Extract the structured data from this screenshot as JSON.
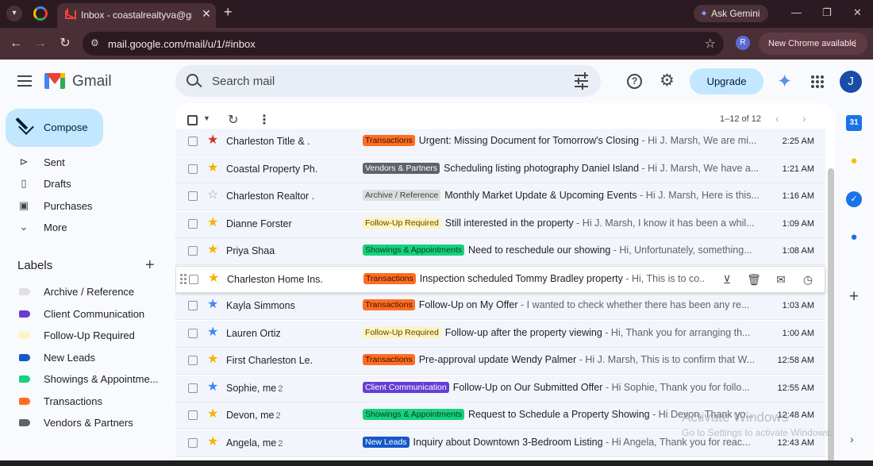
{
  "browser": {
    "tab_title": "Inbox - coastalrealtyva@gmail.",
    "tab_close": "✕",
    "new_tab": "+",
    "ask_gemini": "Ask Gemini",
    "url": "mail.google.com/mail/u/1/#inbox",
    "profile_initial": "R",
    "update_text": "New Chrome available",
    "window_controls": [
      "—",
      "❐",
      "✕"
    ]
  },
  "gmail": {
    "brand": "Gmail",
    "search_placeholder": "Search mail",
    "upgrade": "Upgrade",
    "account_initial": "J"
  },
  "sidebar": {
    "compose": "Compose",
    "nav": [
      {
        "label": "Sent",
        "icon": "send-icon",
        "glyph": "⊳"
      },
      {
        "label": "Drafts",
        "icon": "draft-icon",
        "glyph": "▯"
      },
      {
        "label": "Purchases",
        "icon": "purchases-icon",
        "glyph": "▣"
      },
      {
        "label": "More",
        "icon": "chevron-down-icon",
        "glyph": "⌄"
      }
    ],
    "labels_heading": "Labels",
    "add_label": "+",
    "labels": [
      {
        "name": "Archive / Reference",
        "color": "#e0e0e0"
      },
      {
        "name": "Client Communication",
        "color": "#653ed4"
      },
      {
        "name": "Follow-Up Required",
        "color": "#fff4bd"
      },
      {
        "name": "New Leads",
        "color": "#1457c8"
      },
      {
        "name": "Showings & Appointme...",
        "color": "#16d17d"
      },
      {
        "name": "Transactions",
        "color": "#ff6d23"
      },
      {
        "name": "Vendors & Partners",
        "color": "#5f6368"
      }
    ]
  },
  "toolbar": {
    "page_count": "1–12 of 12"
  },
  "label_styles": {
    "Transactions": {
      "bg": "#ff6d23",
      "fg": "#3b1100"
    },
    "Vendors & Partners": {
      "bg": "#5f6368",
      "fg": "#ffffff"
    },
    "Archive / Reference": {
      "bg": "#dddddd",
      "fg": "#3c4043"
    },
    "Follow-Up Required": {
      "bg": "#fff4bd",
      "fg": "#5f4700"
    },
    "Showings & Appointments": {
      "bg": "#16d17d",
      "fg": "#0b3b23"
    },
    "Client Communication": {
      "bg": "#653ed4",
      "fg": "#ffffff"
    },
    "New Leads": {
      "bg": "#1457c8",
      "fg": "#ffffff"
    }
  },
  "emails": [
    {
      "sender": "Charleston Title & .",
      "count": "",
      "star": "red",
      "label": "Transactions",
      "subject": "Urgent: Missing Document for Tomorrow's Closing",
      "snippet": "Hi J. Marsh, We are mi...",
      "time": "2:25 AM"
    },
    {
      "sender": "Coastal Property Ph.",
      "count": "",
      "star": "yellow",
      "label": "Vendors & Partners",
      "subject": "Scheduling listing photography Daniel Island",
      "snippet": "Hi J. Marsh, We have a...",
      "time": "1:21 AM"
    },
    {
      "sender": "Charleston Realtor .",
      "count": "",
      "star": "empty",
      "label": "Archive / Reference",
      "subject": "Monthly Market Update & Upcoming Events",
      "snippet": "Hi J. Marsh, Here is this...",
      "time": "1:16 AM"
    },
    {
      "sender": "Dianne Forster",
      "count": "",
      "star": "yellow",
      "label": "Follow-Up Required",
      "subject": "Still interested in the property",
      "snippet": "Hi J. Marsh, I know it has been a whil...",
      "time": "1:09 AM"
    },
    {
      "sender": "Priya Shaa",
      "count": "",
      "star": "yellow",
      "label": "Showings & Appointments",
      "subject": "Need to reschedule our showing",
      "snippet": "Hi, Unfortunately, something...",
      "time": "1:08 AM"
    },
    {
      "sender": "Charleston Home Ins.",
      "count": "",
      "star": "yellow",
      "label": "Transactions",
      "subject": "Inspection scheduled Tommy Bradley property",
      "snippet": "Hi, This is to co...",
      "time": "",
      "hovered": true
    },
    {
      "sender": "Kayla Simmons",
      "count": "",
      "star": "blue",
      "label": "Transactions",
      "subject": "Follow-Up on My Offer",
      "snippet": "I wanted to check whether there has been any re...",
      "time": "1:03 AM"
    },
    {
      "sender": "Lauren Ortiz",
      "count": "",
      "star": "blue",
      "label": "Follow-Up Required",
      "subject": "Follow-up after the property viewing",
      "snippet": "Hi, Thank you for arranging th...",
      "time": "1:00 AM"
    },
    {
      "sender": "First Charleston Le.",
      "count": "",
      "star": "yellow",
      "label": "Transactions",
      "subject": "Pre-approval update Wendy Palmer",
      "snippet": "Hi J. Marsh, This is to confirm that W...",
      "time": "12:58 AM"
    },
    {
      "sender": "Sophie, me",
      "count": "2",
      "star": "blue",
      "label": "Client Communication",
      "subject": "Follow-Up on Our Submitted Offer",
      "snippet": "Hi Sophie, Thank you for follo...",
      "time": "12:55 AM"
    },
    {
      "sender": "Devon, me",
      "count": "2",
      "star": "yellow",
      "label": "Showings & Appointments",
      "subject": "Request to Schedule a Property Showing",
      "snippet": "Hi Devon, Thank yo...",
      "time": "12:48 AM"
    },
    {
      "sender": "Angela, me",
      "count": "2",
      "star": "yellow",
      "label": "New Leads",
      "subject": "Inquiry about Downtown 3-Bedroom Listing",
      "snippet": "Hi Angela, Thank you for reac...",
      "time": "12:43 AM"
    }
  ],
  "side_apps": [
    {
      "name": "calendar-icon",
      "glyph": "31"
    },
    {
      "name": "keep-icon",
      "glyph": "●"
    },
    {
      "name": "tasks-icon",
      "glyph": "✓"
    },
    {
      "name": "contacts-icon",
      "glyph": "●"
    }
  ],
  "watermark": {
    "line1": "Activate Windows",
    "line2": "Go to Settings to activate Windows."
  }
}
